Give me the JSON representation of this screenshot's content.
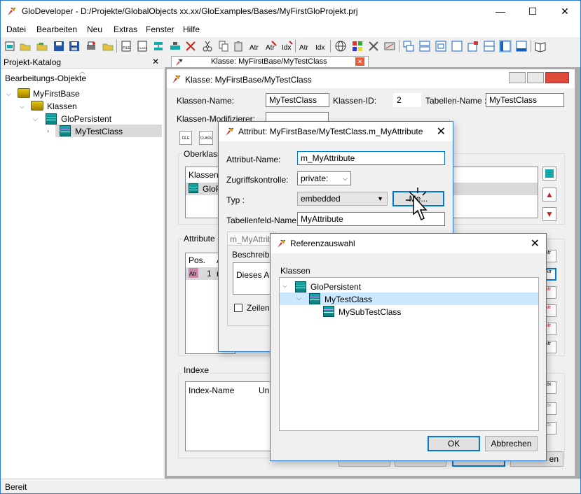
{
  "app": {
    "title": "GloDeveloper - D:/Projekte/GlobalObjects xx.xx/GloExamples/Bases/MyFirstGloProjekt.prj",
    "minimize_glyph": "—",
    "maximize_glyph": "☐",
    "close_glyph": "✕"
  },
  "menu": [
    "Datei",
    "Bearbeiten",
    "Neu",
    "Extras",
    "Fenster",
    "Hilfe"
  ],
  "toolbar_icons": [
    "new-icon",
    "open-icon",
    "open-folder-icon",
    "save-icon",
    "save-all-icon",
    "print-icon",
    "open-file-icon",
    "file-icon",
    "class-icon",
    "tree-icon",
    "fold-icon",
    "cut-icon",
    "copy-icon",
    "paste-icon",
    "attribute-icon",
    "delete-attribute-icon",
    "index-attribute-icon",
    "add-index-icon",
    "globe-icon",
    "grid-icon",
    "tools-icon",
    "settings-icon",
    "window-cascade-icon",
    "window-tile-icon",
    "window-split-icon",
    "window-single-icon",
    "window-multi-icon",
    "window-horizontal-icon",
    "window-vertical-icon",
    "window-layout-icon",
    "help-book-icon"
  ],
  "catalog": {
    "panel_title": "Projekt-Katalog",
    "close_glyph": "✕",
    "heading": "Bearbeitungs-Objekte",
    "tree": [
      {
        "label": "MyFirstBase"
      },
      {
        "label": "Klassen"
      },
      {
        "label": "GloPersistent"
      },
      {
        "label": "MyTestClass"
      }
    ]
  },
  "mdi_tab": {
    "label": "Klasse: MyFirstBase/MyTestClass",
    "close_glyph": "✕"
  },
  "class_window": {
    "title": "Klasse: MyFirstBase/MyTestClass",
    "class_name_label": "Klassen-Name:",
    "class_name_value": "MyTestClass",
    "class_id_label": "Klassen-ID:",
    "class_id_value": "2",
    "table_name_label": "Tabellen-Name :",
    "table_name_value": "MyTestClass",
    "modifier_label": "Klassen-Modifizierer:",
    "file_label": "FILE",
    "class_label": "CLASS",
    "superclass_group": "Oberklasse",
    "superclass_header": "Klassen-",
    "superclass_row": "GloP",
    "attributes_group": "Attribute",
    "attr_col_pos": "Pos.",
    "attr_col_a": "A",
    "attr_row_pos": "1",
    "attr_row_name": "n",
    "indexes_group": "Indexe",
    "index_col_name": "Index-Name",
    "index_col_un": "Un",
    "bottom_button_tail": "en"
  },
  "attribute_dialog": {
    "title": "Attribut: MyFirstBase/MyTestClass.m_MyAttribute",
    "close_glyph": "✕",
    "name_label": "Attribut-Name:",
    "name_value": "m_MyAttribute",
    "access_label": "Zugriffskontrolle:",
    "access_value": "private:",
    "type_label": "Typ :",
    "type_value": "embedded",
    "type_button": "Me...",
    "table_field_label": "Tabellenfeld-Name :",
    "table_field_value": "MyAttribute",
    "tab_label": "m_MyAttrib",
    "description_label": "Beschreibu",
    "description_text": "Dieses At",
    "line_checkbox_label": "Zeilenu"
  },
  "reference_dialog": {
    "title": "Referenzauswahl",
    "close_glyph": "✕",
    "section_label": "Klassen",
    "tree": [
      {
        "label": "GloPersistent",
        "expanded": true,
        "selected": false
      },
      {
        "label": "MyTestClass",
        "expanded": true,
        "selected": true
      },
      {
        "label": "MySubTestClass",
        "expanded": false,
        "selected": false
      }
    ],
    "ok_label": "OK",
    "cancel_label": "Abbrechen"
  },
  "status": {
    "text": "Bereit"
  },
  "colors": {
    "accent": "#0078d7",
    "selection": "#cce8ff",
    "teal_icon": "#11a8a8"
  }
}
